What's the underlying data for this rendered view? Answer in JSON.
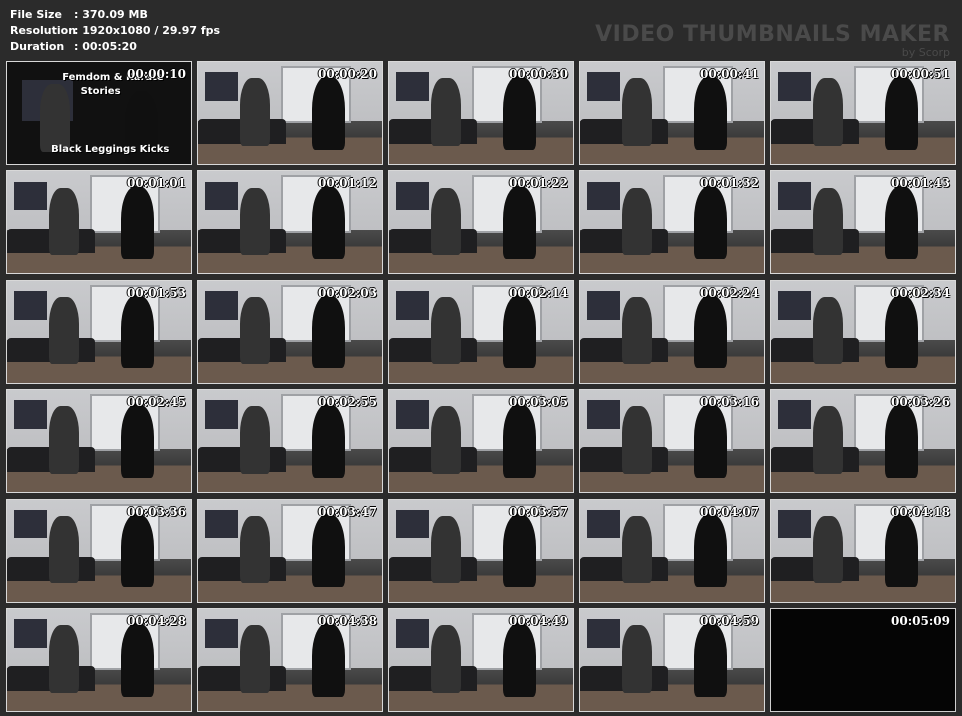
{
  "info": {
    "file_size_label": "File Size",
    "file_size_value": ": 370.09 MB",
    "resolution_label": "Resolution",
    "resolution_value": ": 1920x1080 / 29.97 fps",
    "duration_label": "Duration",
    "duration_value": ": 00:05:20"
  },
  "brand": {
    "title": "VIDEO THUMBNAILS MAKER",
    "subtitle": "by Scorp"
  },
  "first_thumb": {
    "line1": "Femdom & Karate",
    "line2": "Stories",
    "line3": "Black Leggings Kicks"
  },
  "thumbnails": [
    "00:00:10",
    "00:00:20",
    "00:00:30",
    "00:00:41",
    "00:00:51",
    "00:01:01",
    "00:01:12",
    "00:01:22",
    "00:01:32",
    "00:01:43",
    "00:01:53",
    "00:02:03",
    "00:02:14",
    "00:02:24",
    "00:02:34",
    "00:02:45",
    "00:02:55",
    "00:03:05",
    "00:03:16",
    "00:03:26",
    "00:03:36",
    "00:03:47",
    "00:03:57",
    "00:04:07",
    "00:04:18",
    "00:04:28",
    "00:04:38",
    "00:04:49",
    "00:04:59",
    "00:05:09"
  ]
}
